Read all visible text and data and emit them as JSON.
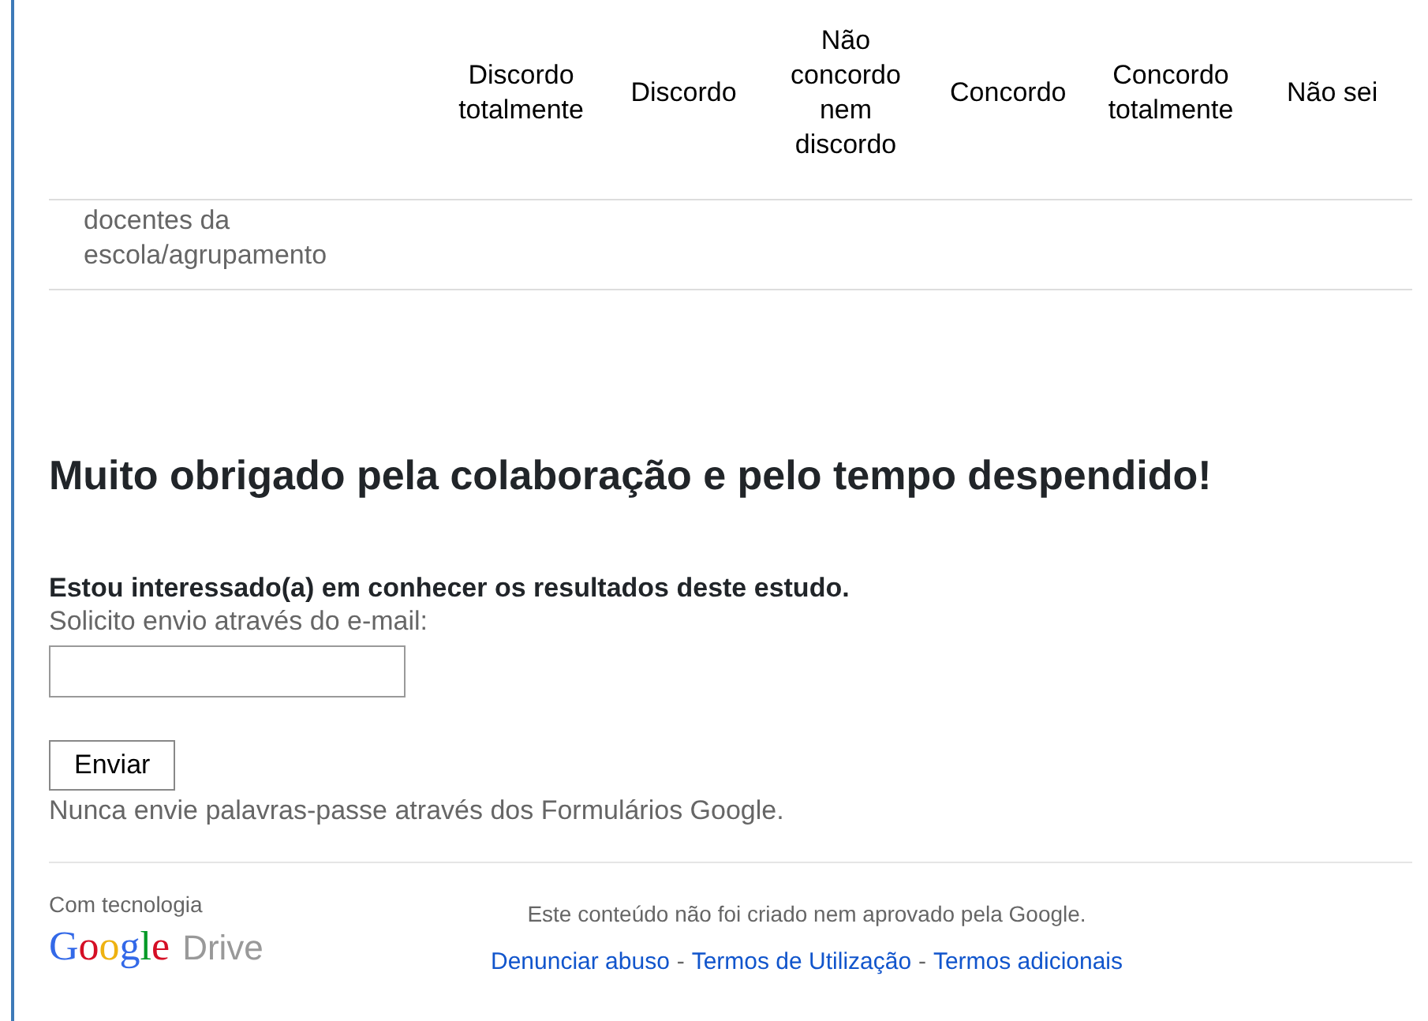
{
  "grid": {
    "columns": [
      "Discordo totalmente",
      "Discordo",
      "Não concordo nem discordo",
      "Concordo",
      "Concordo totalmente",
      "Não sei"
    ],
    "rows": [
      {
        "label": "docentes da escola/agrupamento"
      }
    ]
  },
  "confirmation": {
    "title": "Muito obrigado pela colaboração e pelo tempo despendido!"
  },
  "question": {
    "title": "Estou interessado(a) em conhecer os resultados deste estudo.",
    "help": "Solicito envio através do e-mail:"
  },
  "submit": {
    "label": "Enviar"
  },
  "warning": "Nunca envie palavras-passe através dos Formulários Google.",
  "footer": {
    "powered_by": "Com tecnologia",
    "logo_word": "Google",
    "logo_suffix": "Drive",
    "disclaimer": "Este conteúdo não foi criado nem aprovado pela Google.",
    "links": [
      "Denunciar abuso",
      "Termos de Utilização",
      "Termos adicionais"
    ],
    "separator": "-"
  }
}
